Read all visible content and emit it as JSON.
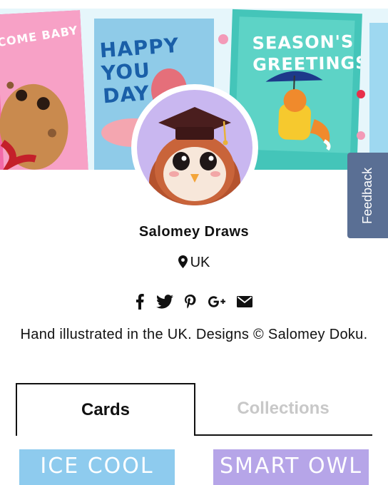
{
  "banner": {
    "card1_text": "COME BABY",
    "card2_text": "HAPPY YOU DAY!",
    "card3_text": "SEASON'S GREETINGS"
  },
  "profile": {
    "name": "Salomey Draws",
    "location": "UK",
    "bio": "Hand illustrated in the UK. Designs © Salomey Doku."
  },
  "socials": [
    "facebook-icon",
    "twitter-icon",
    "pinterest-icon",
    "google-plus-icon",
    "email-icon"
  ],
  "feedback": {
    "label": "Feedback",
    "color": "#5a6f94"
  },
  "tabs": [
    {
      "label": "Cards",
      "active": true
    },
    {
      "label": "Collections",
      "active": false
    }
  ],
  "products": [
    {
      "title": "ICE COOL",
      "color": "#8ecbee"
    },
    {
      "title": "SMART OWL",
      "color": "#b6a5e8"
    }
  ]
}
